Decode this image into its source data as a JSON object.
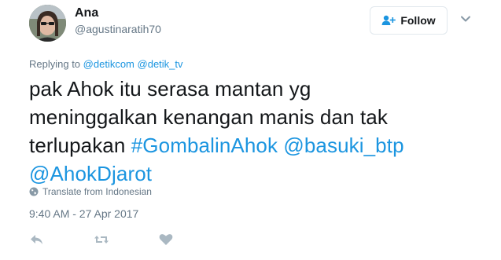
{
  "user": {
    "display_name": "Ana",
    "handle": "@agustinaratih70"
  },
  "follow_button": {
    "label": "Follow"
  },
  "reply_context": {
    "prefix": "Replying to",
    "mentions": [
      "@detikcom",
      "@detik_tv"
    ]
  },
  "tweet": {
    "line1": "pak Ahok itu serasa mantan yg",
    "line2": "meninggalkan kenangan manis dan tak",
    "line3_text": "terlupakan ",
    "hashtag": "#GombalinAhok",
    "mention1": "@basuki_btp",
    "mention2": "@AhokDjarot"
  },
  "translate": {
    "label": "Translate from Indonesian"
  },
  "timestamp": "9:40 AM - 27 Apr 2017",
  "colors": {
    "link": "#1b95e0",
    "muted": "#657786",
    "text": "#14171a",
    "border": "#e1e8ed"
  },
  "icons": {
    "follow": "add-user-icon",
    "menu": "chevron-down-icon",
    "translate": "globe-icon",
    "reply": "reply-icon",
    "retweet": "retweet-icon",
    "like": "heart-icon"
  }
}
